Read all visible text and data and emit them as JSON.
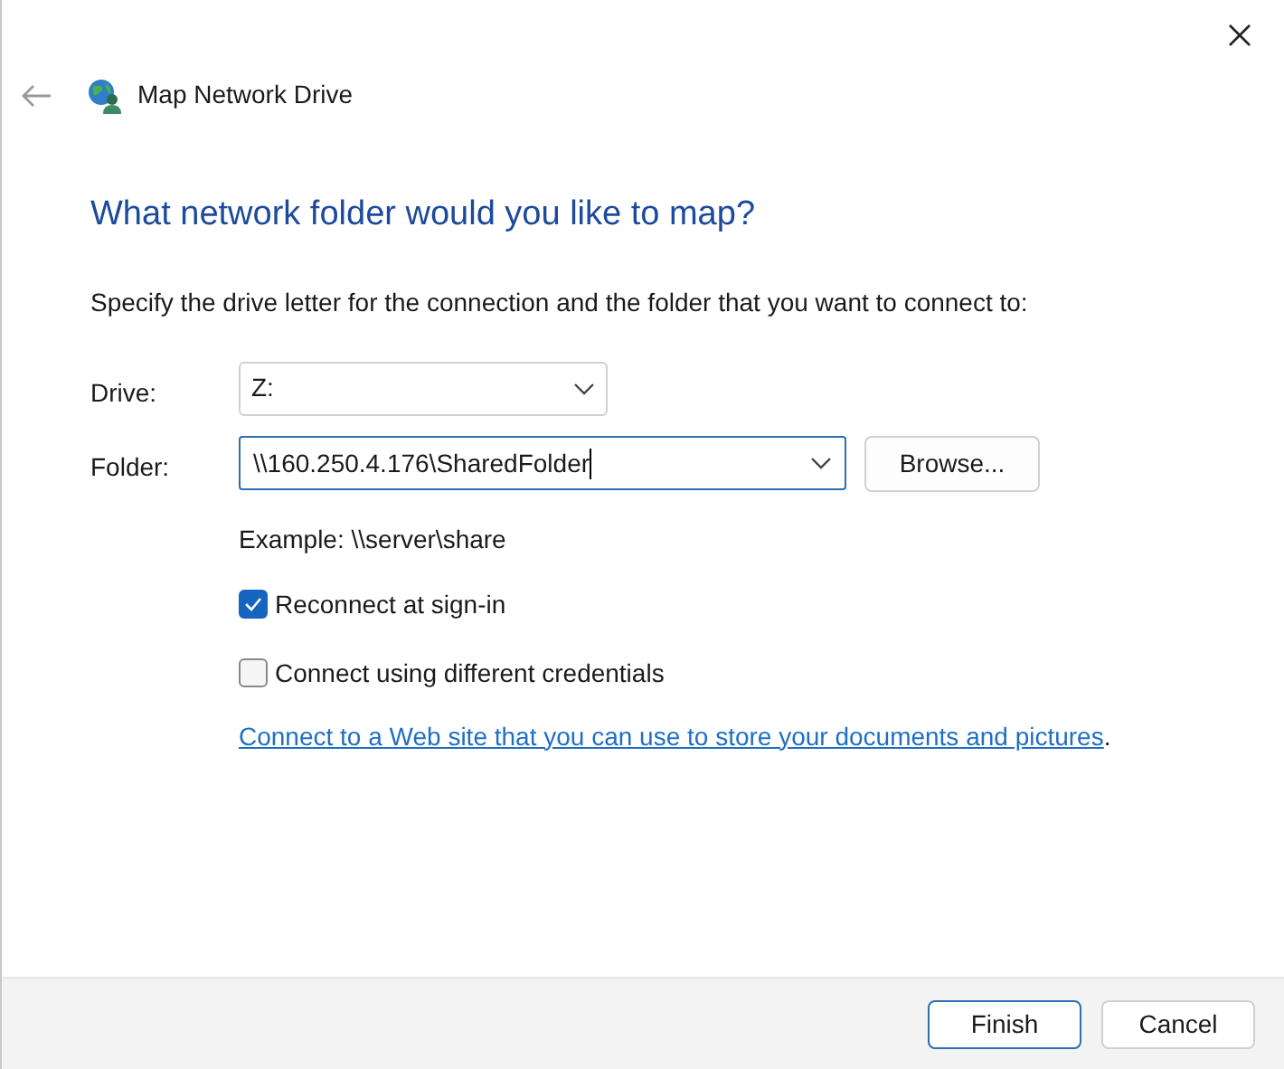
{
  "window": {
    "title": "Map Network Drive"
  },
  "heading": "What network folder would you like to map?",
  "description": "Specify the drive letter for the connection and the folder that you want to connect to:",
  "drive": {
    "label": "Drive:",
    "value": "Z:"
  },
  "folder": {
    "label": "Folder:",
    "value": "\\\\160.250.4.176\\SharedFolder",
    "focused": true
  },
  "browse_button": "Browse...",
  "example": "Example: \\\\server\\share",
  "options": [
    {
      "label": "Reconnect at sign-in",
      "checked": true
    },
    {
      "label": "Connect using different credentials",
      "checked": false
    }
  ],
  "link": {
    "text": "Connect to a Web site that you can use to store your documents and pictures",
    "after": "."
  },
  "buttons": [
    {
      "label": "Finish",
      "default": true
    },
    {
      "label": "Cancel",
      "default": false
    }
  ]
}
